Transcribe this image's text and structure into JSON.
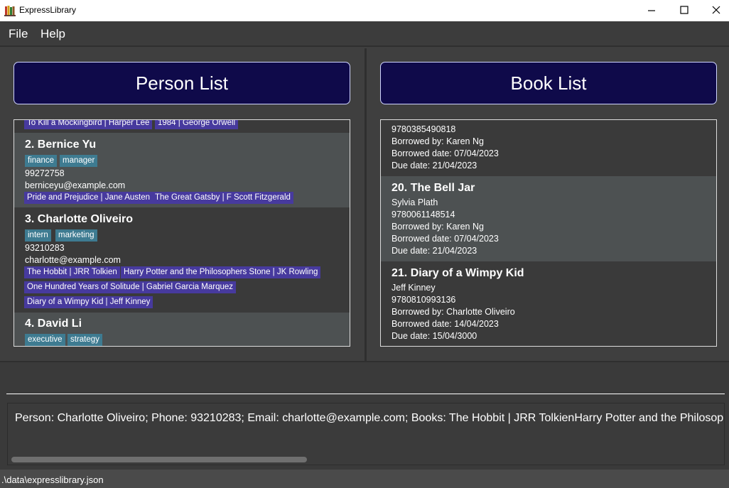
{
  "window": {
    "title": "ExpressLibrary"
  },
  "menu": {
    "file": "File",
    "help": "Help"
  },
  "person_list": {
    "header": "Person List",
    "top_partial": {
      "books": [
        "To Kill a Mockingbird | Harper Lee",
        "1984 | George Orwell"
      ]
    },
    "persons": [
      {
        "name": "2.  Bernice Yu",
        "tags": [
          "finance",
          "manager"
        ],
        "phone": "99272758",
        "email": "berniceyu@example.com",
        "books": [
          "Pride and Prejudice | Jane Austen",
          "The Great Gatsby | F Scott Fitzgerald"
        ]
      },
      {
        "name": "3.  Charlotte Oliveiro",
        "tags": [
          "intern",
          "marketing"
        ],
        "phone": "93210283",
        "email": "charlotte@example.com",
        "books": [
          "The Hobbit | JRR Tolkien",
          "Harry Potter and the Philosophers Stone | JK Rowling",
          "One Hundred Years of Solitude | Gabriel Garcia Marquez",
          "Diary of a Wimpy Kid | Jeff Kinney"
        ]
      },
      {
        "name": "4.  David Li",
        "tags": [
          "executive",
          "strategy"
        ]
      }
    ]
  },
  "book_list": {
    "header": "Book List",
    "top_partial": {
      "isbn": "9780385490818",
      "borrowed_by": "Borrowed by: Karen Ng",
      "borrowed_date": "Borrowed date: 07/04/2023",
      "due_date": "Due date: 21/04/2023"
    },
    "books": [
      {
        "title": "20.  The Bell Jar",
        "author": "Sylvia Plath",
        "isbn": "9780061148514",
        "borrowed_by": "Borrowed by: Karen Ng",
        "borrowed_date": "Borrowed date: 07/04/2023",
        "due_date": "Due date: 21/04/2023"
      },
      {
        "title": "21.  Diary of a Wimpy Kid",
        "author": "Jeff Kinney",
        "isbn": "9780810993136",
        "borrowed_by": "Borrowed by: Charlotte Oliveiro",
        "borrowed_date": "Borrowed date: 14/04/2023",
        "due_date": "Due date: 15/04/3000"
      }
    ]
  },
  "command": {
    "value": ""
  },
  "result": {
    "text": "Person: Charlotte Oliveiro; Phone: 93210283; Email: charlotte@example.com; Books: The Hobbit | JRR TolkienHarry Potter and the Philosophers Stone | JK Rowling"
  },
  "status": {
    "path": ".\\data\\expresslibrary.json"
  },
  "colors": {
    "header_bg": "#0f0a4a",
    "tag_bg": "#3e7b91",
    "book_tag_bg": "#473a9e",
    "card_light": "#4d5152"
  }
}
